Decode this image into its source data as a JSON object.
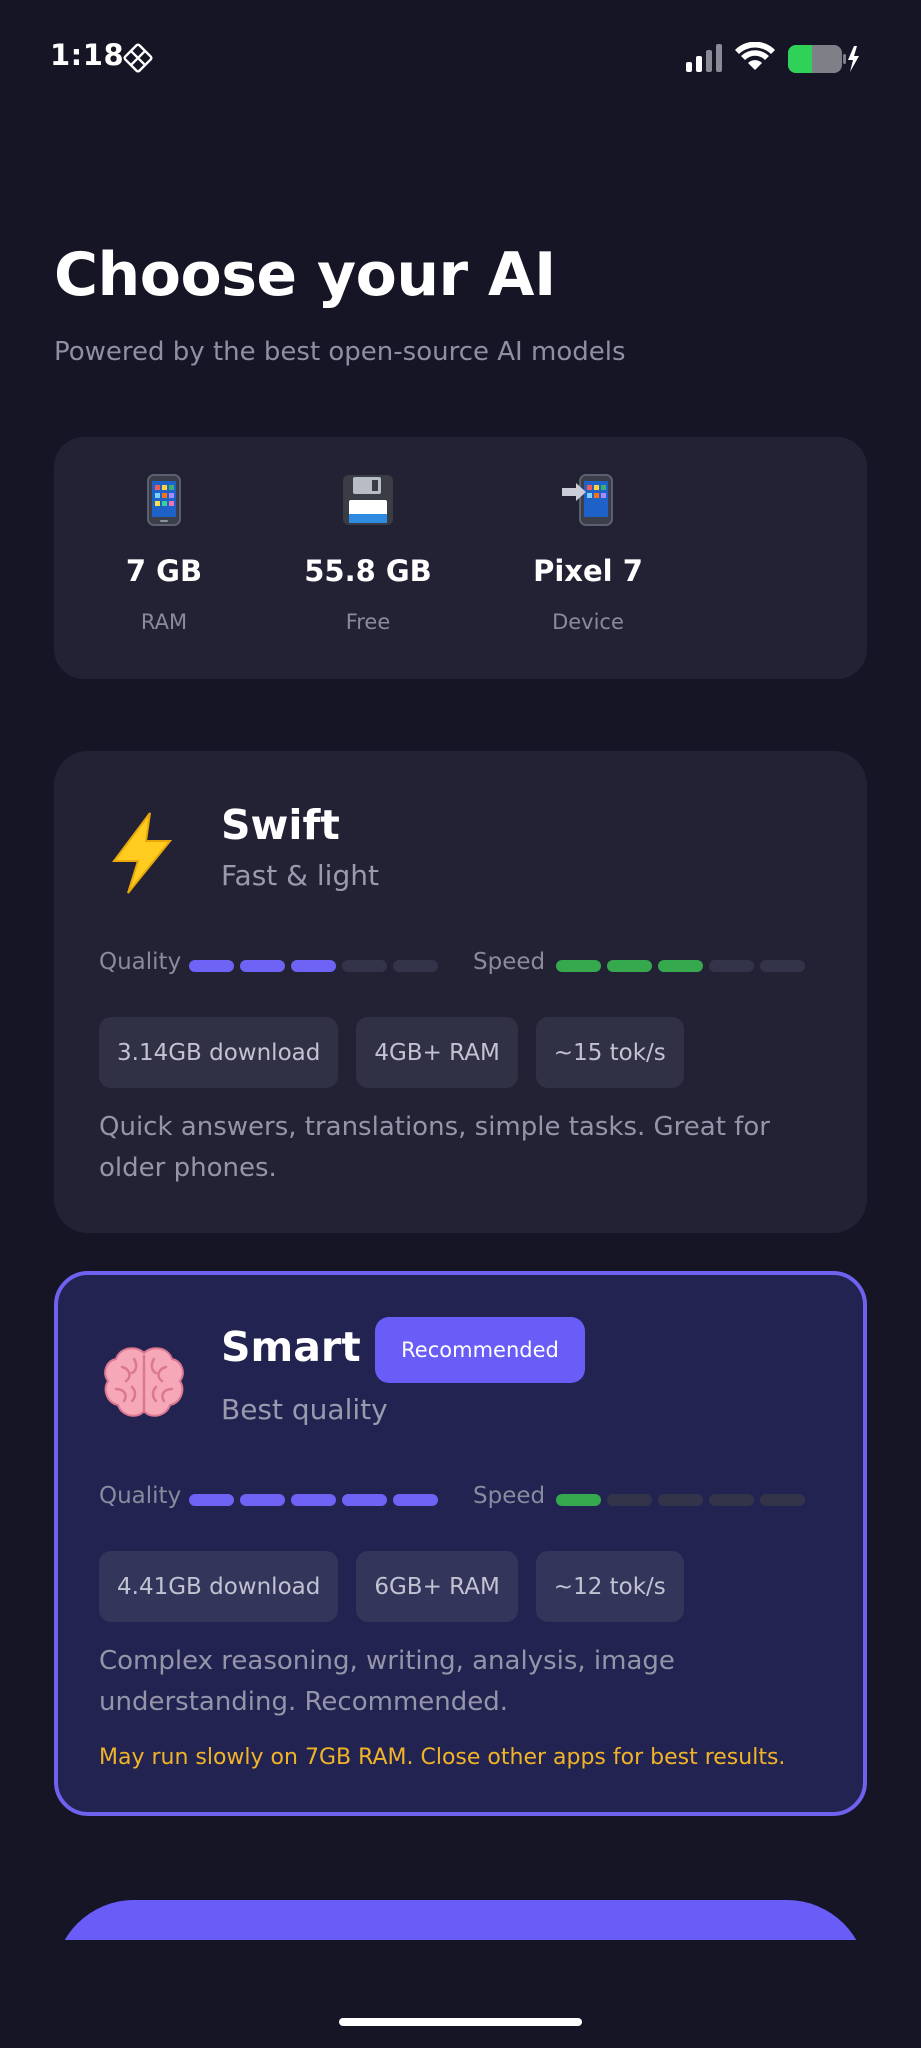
{
  "status_bar": {
    "time": "1:18",
    "app_icon": "diamond-grid-icon",
    "signal_icon": "cellular-signal-icon",
    "wifi_icon": "wifi-icon",
    "battery_icon": "battery-charging-icon",
    "battery_color": "#30d158"
  },
  "header": {
    "title": "Choose your AI",
    "subtitle": "Powered by the best open-source AI models"
  },
  "device": {
    "stats": [
      {
        "icon": "mobile-phone-icon",
        "value": "7 GB",
        "label": "RAM"
      },
      {
        "icon": "floppy-disk-icon",
        "value": "55.8 GB",
        "label": "Free"
      },
      {
        "icon": "phone-arrow-icon",
        "value": "Pixel 7",
        "label": "Device"
      }
    ]
  },
  "models": [
    {
      "icon": "lightning-icon",
      "name": "Swift",
      "tagline": "Fast & light",
      "quality_label": "Quality",
      "quality": 3,
      "speed_label": "Speed",
      "speed": 3,
      "max": 5,
      "chips": [
        "3.14GB download",
        "4GB+ RAM",
        "~15 tok/s"
      ],
      "description": "Quick answers, translations, simple tasks. Great for older phones.",
      "selected": false
    },
    {
      "icon": "brain-icon",
      "name": "Smart",
      "badge": "Recommended",
      "tagline": "Best quality",
      "quality_label": "Quality",
      "quality": 5,
      "speed_label": "Speed",
      "speed": 1,
      "max": 5,
      "chips": [
        "4.41GB download",
        "6GB+ RAM",
        "~12 tok/s"
      ],
      "description": "Complex reasoning, writing, analysis, image understanding. Recommended.",
      "warning": "May run slowly on 7GB RAM. Close other apps for best results.",
      "selected": true
    }
  ],
  "colors": {
    "background": "#151526",
    "card": "#222234",
    "accent": "#6a5cf6",
    "quality_bar": "#6e63f5",
    "speed_bar": "#36a84e",
    "warning": "#f1b429"
  }
}
